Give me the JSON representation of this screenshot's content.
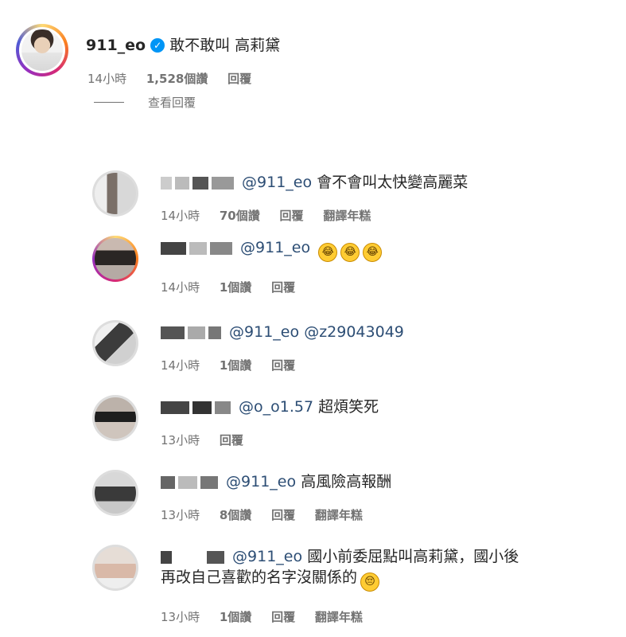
{
  "post": {
    "username": "911_eo",
    "text": "敢不敢叫 高莉黛",
    "time": "14小時",
    "likes": "1,528個讚",
    "reply": "回覆"
  },
  "view_replies": "查看回覆",
  "comments": [
    {
      "mention": "@911_eo",
      "text": "會不會叫太快變高麗菜",
      "time": "14小時",
      "likes": "70個讚",
      "reply": "回覆",
      "translate": "翻譯年糕"
    },
    {
      "mention": "@911_eo",
      "emoji_icon": "rofl-emoji-icon",
      "emoji_glyph": "😂",
      "time": "14小時",
      "likes": "1個讚",
      "reply": "回覆"
    },
    {
      "mention": "@911_eo",
      "mention2": "@z29043049",
      "time": "14小時",
      "likes": "1個讚",
      "reply": "回覆"
    },
    {
      "mention": "@o_o1.57",
      "text": "超煩笑死",
      "time": "13小時",
      "reply": "回覆"
    },
    {
      "mention": "@911_eo",
      "text": "高風險高報酬",
      "time": "13小時",
      "likes": "8個讚",
      "reply": "回覆",
      "translate": "翻譯年糕"
    },
    {
      "mention": "@911_eo",
      "text": "國小前委屈點叫高莉黛，國小後",
      "text_line2": "再改自己喜歡的名字沒關係的",
      "emoji_icon": "pensive-emoji-icon",
      "emoji_glyph": "😔",
      "time": "13小時",
      "likes": "1個讚",
      "reply": "回覆",
      "translate": "翻譯年糕"
    }
  ],
  "colors": {
    "mention": "#2c4d74",
    "meta": "#737373",
    "verified": "#0095f6"
  }
}
